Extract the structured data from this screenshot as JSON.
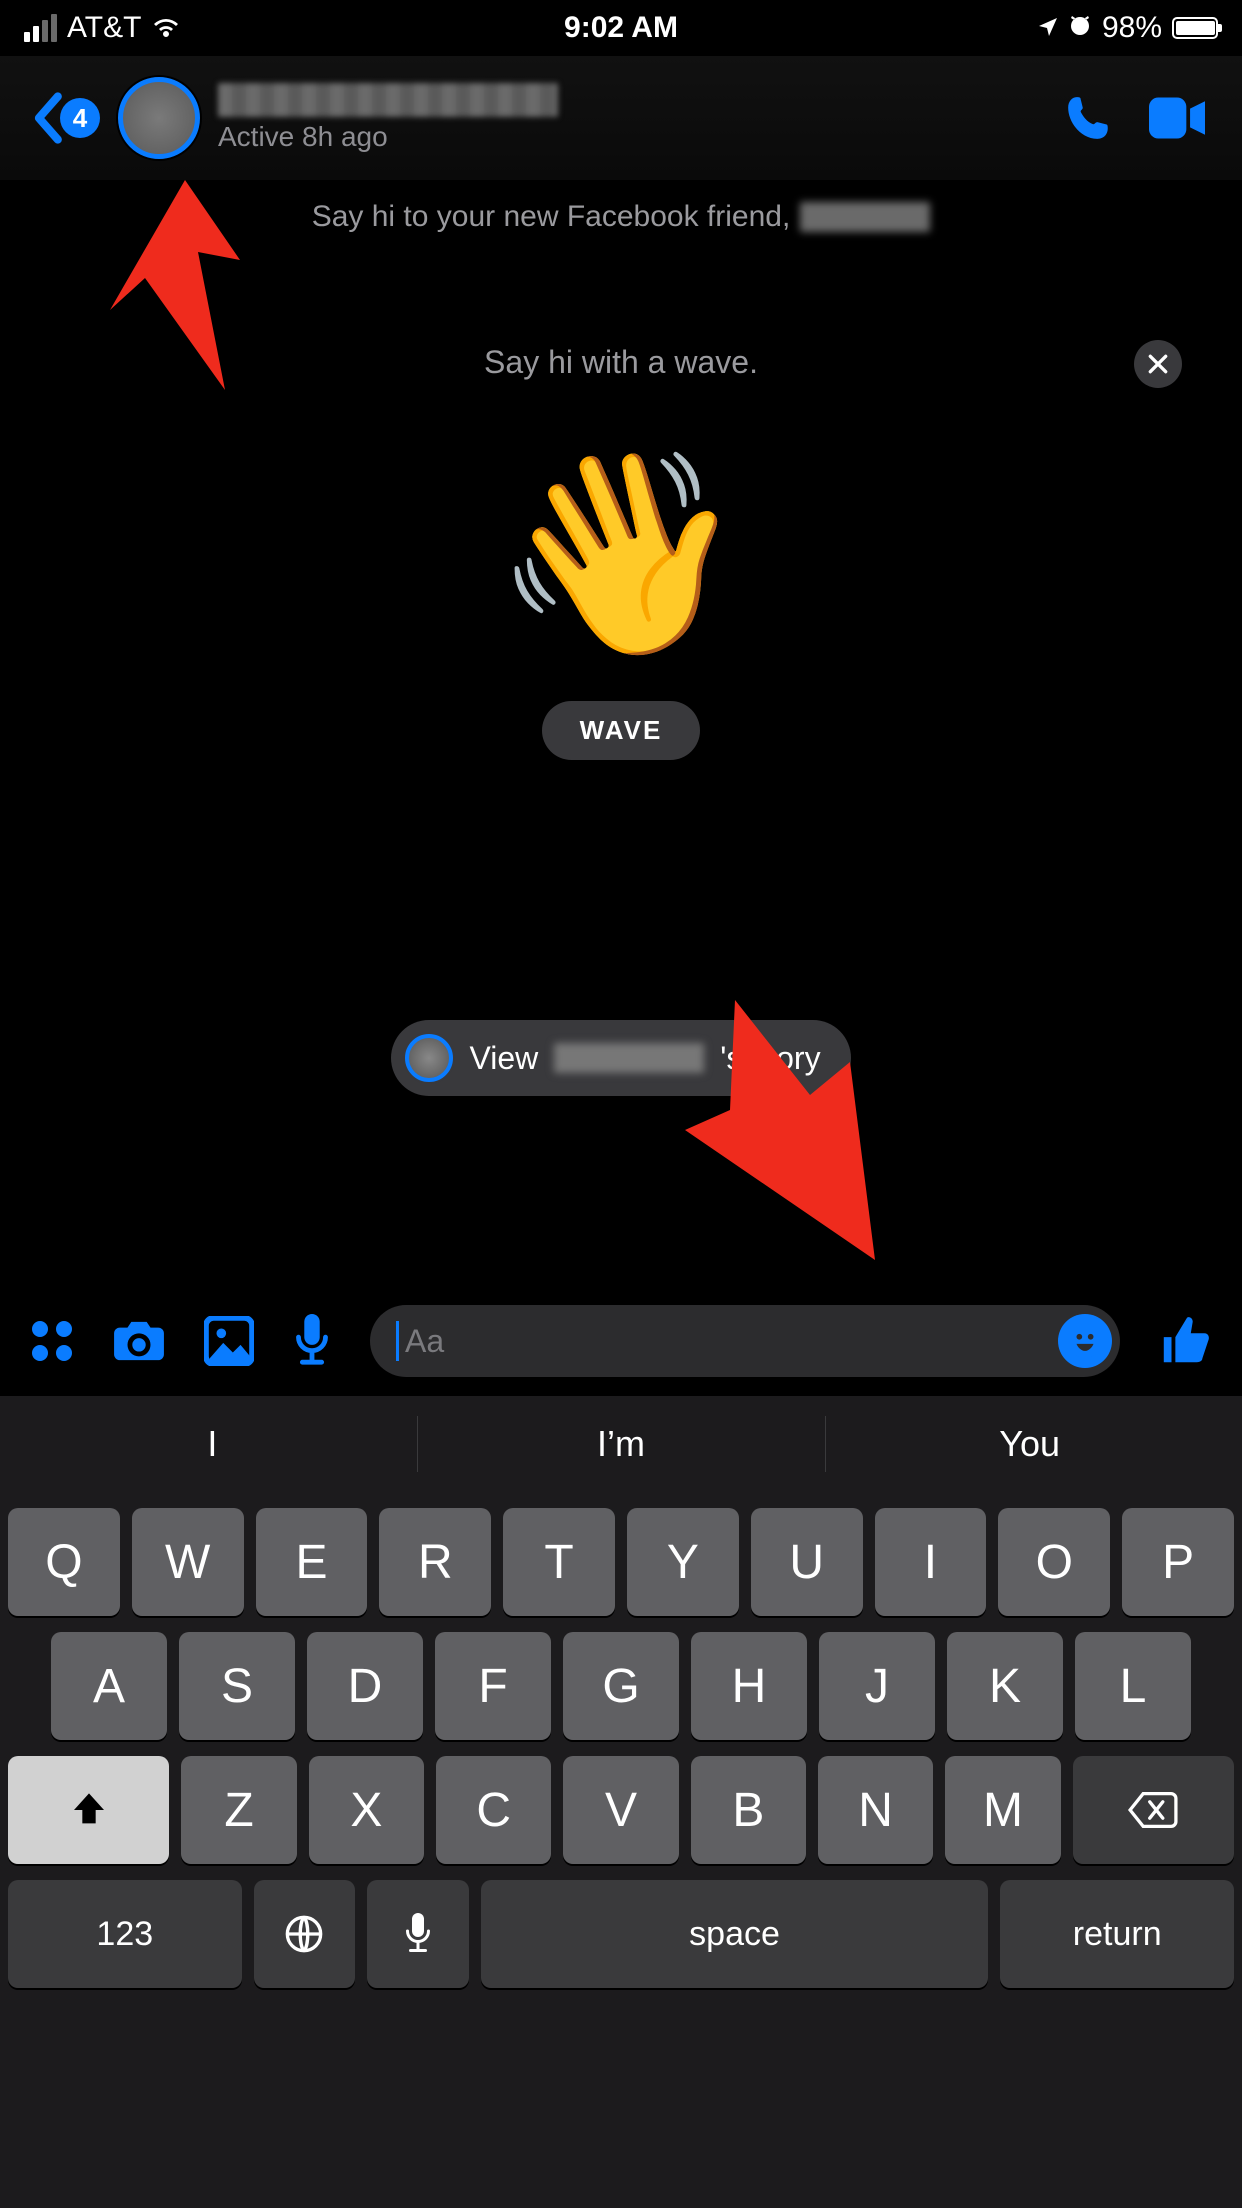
{
  "status_bar": {
    "carrier": "AT&T",
    "time": "9:02 AM",
    "battery_percent": "98%",
    "battery_fill_pct": 98
  },
  "header": {
    "back_badge": "4",
    "contact_name_redacted": true,
    "active_status": "Active 8h ago"
  },
  "conversation": {
    "intro_prefix": "Say hi to your new Facebook friend,",
    "wave_prompt": "Say hi with a wave.",
    "wave_button": "WAVE",
    "story_prefix": "View",
    "story_suffix": "'s story"
  },
  "composer": {
    "placeholder": "Aa"
  },
  "keyboard": {
    "suggestions": [
      "I",
      "I’m",
      "You"
    ],
    "row1": [
      "Q",
      "W",
      "E",
      "R",
      "T",
      "Y",
      "U",
      "I",
      "O",
      "P"
    ],
    "row2": [
      "A",
      "S",
      "D",
      "F",
      "G",
      "H",
      "J",
      "K",
      "L"
    ],
    "row3": [
      "Z",
      "X",
      "C",
      "V",
      "B",
      "N",
      "M"
    ],
    "num_key": "123",
    "space_key": "space",
    "return_key": "return"
  }
}
